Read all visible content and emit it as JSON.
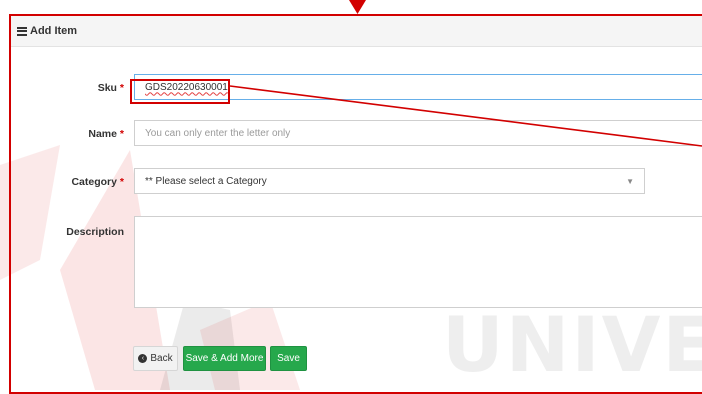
{
  "panel": {
    "title": "Add Item",
    "title_icon": "list-icon",
    "border_color": "#d20000"
  },
  "form": {
    "sku": {
      "label": "Sku",
      "required_mark": "*",
      "value": "GDS20220630001"
    },
    "name": {
      "label": "Name",
      "required_mark": "*",
      "placeholder": "You can only enter the letter only"
    },
    "category": {
      "label": "Category",
      "required_mark": "*",
      "selected": "** Please select a Category",
      "caret_icon": "caret-down-icon"
    },
    "description": {
      "label": "Description",
      "value": ""
    }
  },
  "buttons": {
    "back": {
      "label": "Back",
      "icon": "circle-chevron-left-icon"
    },
    "save_add_more": {
      "label": "Save & Add More"
    },
    "save": {
      "label": "Save"
    }
  },
  "watermark": {
    "text": "UNIVERS"
  },
  "colors": {
    "annotation_red": "#d20000",
    "button_green": "#26a84c",
    "focus_border": "#66afe9"
  }
}
